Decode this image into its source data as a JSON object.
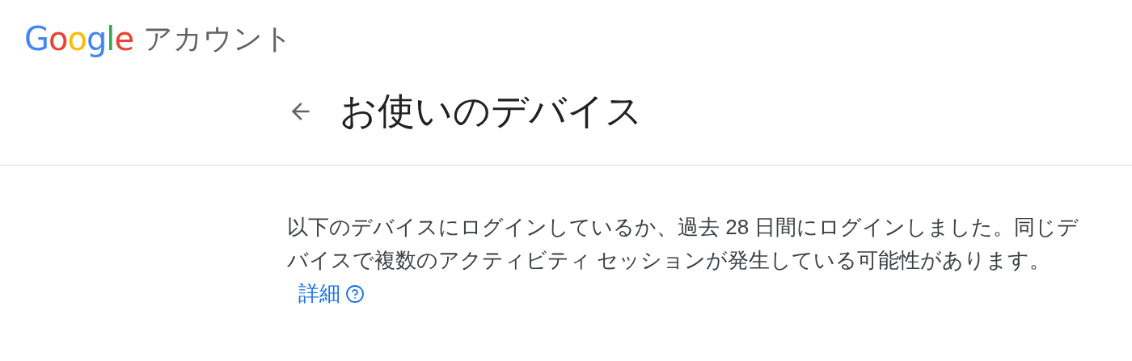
{
  "header": {
    "logo": "Google",
    "product": "アカウント"
  },
  "page": {
    "title": "お使いのデバイス"
  },
  "description": {
    "text": "以下のデバイスにログインしているか、過去 28 日間にログインしました。同じデバイスで複数のアクティビティ セッションが発生している可能性があります。",
    "link": "詳細"
  }
}
